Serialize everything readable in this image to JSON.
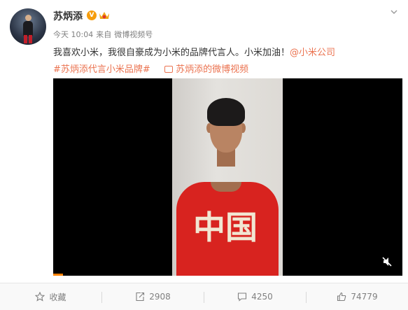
{
  "post": {
    "author": "苏炳添",
    "verified_badge": "V",
    "time": "今天 10:04",
    "source_prefix": "来自",
    "source": "微博视频号",
    "text": "我喜欢小米，我很自豪成为小米的品牌代言人。小米加油！",
    "mention": "@小米公司",
    "tag": "#苏炳添代言小米品牌#",
    "video_link": "苏炳添的微博视频",
    "shirt_text": "中国"
  },
  "actions": {
    "favorite": "收藏",
    "repost": "2908",
    "comment": "4250",
    "like": "74779"
  },
  "colors": {
    "link": "#eb7350",
    "verified": "#f69d0d",
    "progress": "#ff8200",
    "shirt": "#d8231f"
  },
  "icons": [
    "avatar",
    "verified-v-icon",
    "crown-icon",
    "chevron-down-icon",
    "video-link-icon",
    "mute-icon",
    "favorite-star-icon",
    "repost-icon",
    "comment-icon",
    "like-thumb-icon"
  ]
}
